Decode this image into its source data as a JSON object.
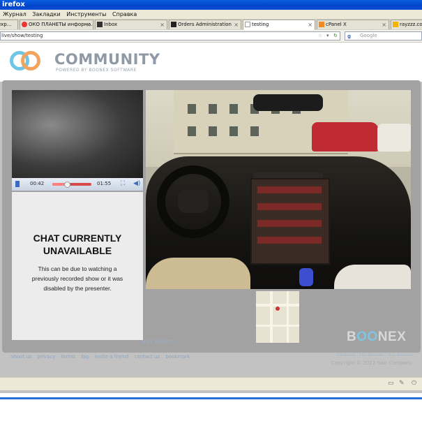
{
  "window": {
    "title": "irefox"
  },
  "menu": [
    "Журнал",
    "Закладки",
    "Инструменты",
    "Справка"
  ],
  "tabs": [
    {
      "label": "exp...",
      "icon": "page-icon"
    },
    {
      "label": "ОКО ПЛАНЕТЫ информа...",
      "icon": "eye-icon"
    },
    {
      "label": "Inbox",
      "icon": "mail-icon"
    },
    {
      "label": "Orders Administration",
      "icon": "admin-icon"
    },
    {
      "label": "testing",
      "icon": "page-icon",
      "active": true
    },
    {
      "label": "cPanel X",
      "icon": "cpanel-icon"
    },
    {
      "label": "rayzzz.com",
      "icon": "site-icon"
    }
  ],
  "nav": {
    "url": "live/show/testing",
    "search_placeholder": "Google"
  },
  "site": {
    "logo_word": "COMMUNITY",
    "logo_tagline": "POWERED BY BOONEX SOFTWARE",
    "footer_links": [
      "about us",
      "privacy",
      "terms",
      "faq",
      "invite a friend",
      "contact us",
      "bookmark"
    ],
    "footer_right": "Solutions | Join Boonex | Buy Boonex",
    "copyright": "Copyright © 2012 Your Company.",
    "experts_link": "ware Experts"
  },
  "player": {
    "current_time": "00:42",
    "total_time": "01:55",
    "progress_fraction": 0.36
  },
  "chat": {
    "title_line1": "CHAT CURRENTLY",
    "title_line2": "UNAVAILABLE",
    "message": "This can be due to watching a previously recorded show or it was disabled by the presenter."
  },
  "brand": {
    "left": "B",
    "oo": "OO",
    "right": "NEX"
  }
}
